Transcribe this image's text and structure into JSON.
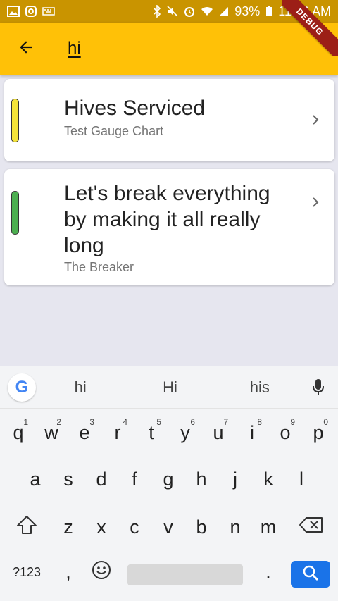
{
  "status_bar": {
    "battery": "93%",
    "time": "11:12 AM"
  },
  "app_bar": {
    "search_text": "hi"
  },
  "debug_banner": "DEBUG",
  "results": [
    {
      "title": "Hives Serviced",
      "subtitle": "Test Gauge Chart",
      "indicator_color": "#f5e43a"
    },
    {
      "title": "Let's break everything by making it all really long",
      "subtitle": "The Breaker",
      "indicator_color": "#4caf50"
    }
  ],
  "keyboard": {
    "suggestions": [
      "hi",
      "Hi",
      "his"
    ],
    "row1": [
      "q",
      "w",
      "e",
      "r",
      "t",
      "y",
      "u",
      "i",
      "o",
      "p"
    ],
    "row1_nums": [
      "1",
      "2",
      "3",
      "4",
      "5",
      "6",
      "7",
      "8",
      "9",
      "0"
    ],
    "row2": [
      "a",
      "s",
      "d",
      "f",
      "g",
      "h",
      "j",
      "k",
      "l"
    ],
    "row3": [
      "z",
      "x",
      "c",
      "v",
      "b",
      "n",
      "m"
    ],
    "symbols_label": "?123",
    "comma": ",",
    "period": "."
  },
  "colors": {
    "app_bar": "#ffc107",
    "status_bar": "#c99400",
    "background": "#e6e6ef",
    "search_key": "#1a73e8"
  }
}
